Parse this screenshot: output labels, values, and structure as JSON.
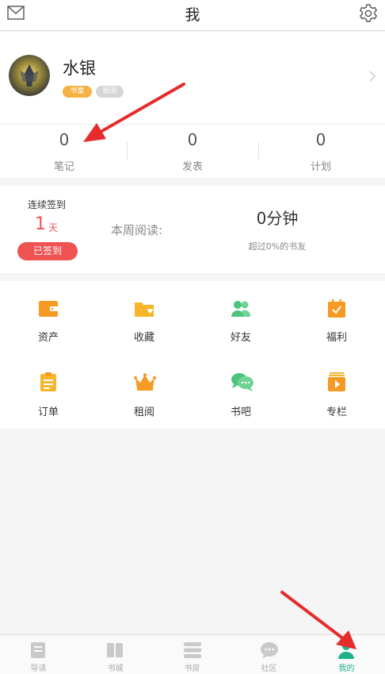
{
  "header": {
    "title": "我"
  },
  "profile": {
    "username": "水银",
    "badges": [
      "书童",
      "租阅"
    ]
  },
  "stats": [
    {
      "value": "0",
      "label": "笔记"
    },
    {
      "value": "0",
      "label": "发表"
    },
    {
      "value": "0",
      "label": "计划"
    }
  ],
  "signin": {
    "streak_label": "连续签到",
    "streak_days": "1",
    "streak_unit": "天",
    "signed_button": "已签到",
    "week_label": "本周阅读:",
    "week_minutes": "0分钟",
    "percent_text": "超过0%的书友"
  },
  "grid": [
    {
      "label": "资产",
      "icon": "wallet-icon"
    },
    {
      "label": "收藏",
      "icon": "folder-heart-icon"
    },
    {
      "label": "好友",
      "icon": "friends-icon"
    },
    {
      "label": "福利",
      "icon": "gift-calendar-icon"
    },
    {
      "label": "订单",
      "icon": "clipboard-icon"
    },
    {
      "label": "租阅",
      "icon": "crown-icon"
    },
    {
      "label": "书吧",
      "icon": "chat-bubbles-icon"
    },
    {
      "label": "专栏",
      "icon": "play-book-icon"
    }
  ],
  "tabbar": [
    {
      "label": "导读",
      "icon": "guide-icon"
    },
    {
      "label": "书城",
      "icon": "bookstore-icon"
    },
    {
      "label": "书房",
      "icon": "bookshelf-icon"
    },
    {
      "label": "社区",
      "icon": "community-icon"
    },
    {
      "label": "我的",
      "icon": "profile-icon",
      "active": true
    }
  ],
  "colors": {
    "accent_red": "#f05252",
    "accent_green": "#1fb08c",
    "badge_gold": "#f5b142"
  }
}
